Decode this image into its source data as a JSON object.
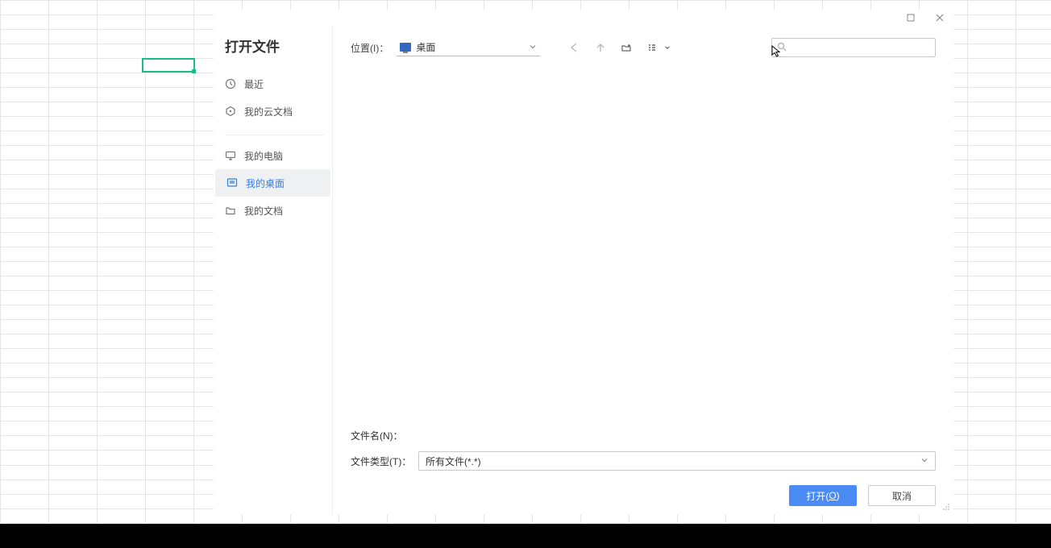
{
  "dialog": {
    "title": "打开文件",
    "sidebar": {
      "recent": "最近",
      "cloud": "我的云文档",
      "computer": "我的电脑",
      "desktop": "我的桌面",
      "documents": "我的文档"
    },
    "toolbar": {
      "location_label": "位置(I)：",
      "location_value": "桌面"
    },
    "bottom": {
      "filename_label": "文件名(N)：",
      "filetype_label": "文件类型(T)：",
      "filetype_value": "所有文件(*.*)"
    },
    "buttons": {
      "open_prefix": "打开(",
      "open_key": "O",
      "open_suffix": ")",
      "cancel": "取消"
    }
  }
}
